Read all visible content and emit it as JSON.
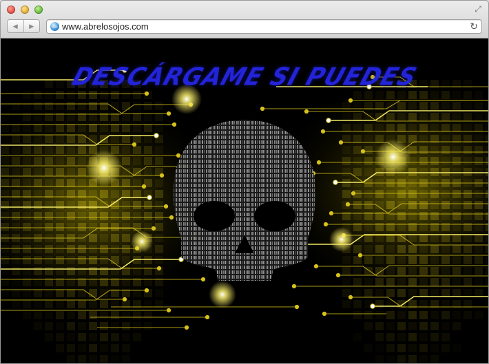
{
  "browser": {
    "url": "www.abrelosojos.com"
  },
  "page": {
    "headline": "DESCÁRGAME SI PUEDES"
  },
  "colors": {
    "headline": "#2323d8",
    "circuit": "#d6c21a",
    "circuit_glow": "#fff36a",
    "skull_text": "#8a8a8a"
  },
  "icons": {
    "close": "close-traffic-light",
    "minimize": "minimize-traffic-light",
    "maximize": "maximize-traffic-light",
    "fullscreen": "fullscreen-arrows-icon",
    "back": "back-arrow-icon",
    "forward": "forward-arrow-icon",
    "site": "globe-icon",
    "reload": "reload-icon"
  }
}
